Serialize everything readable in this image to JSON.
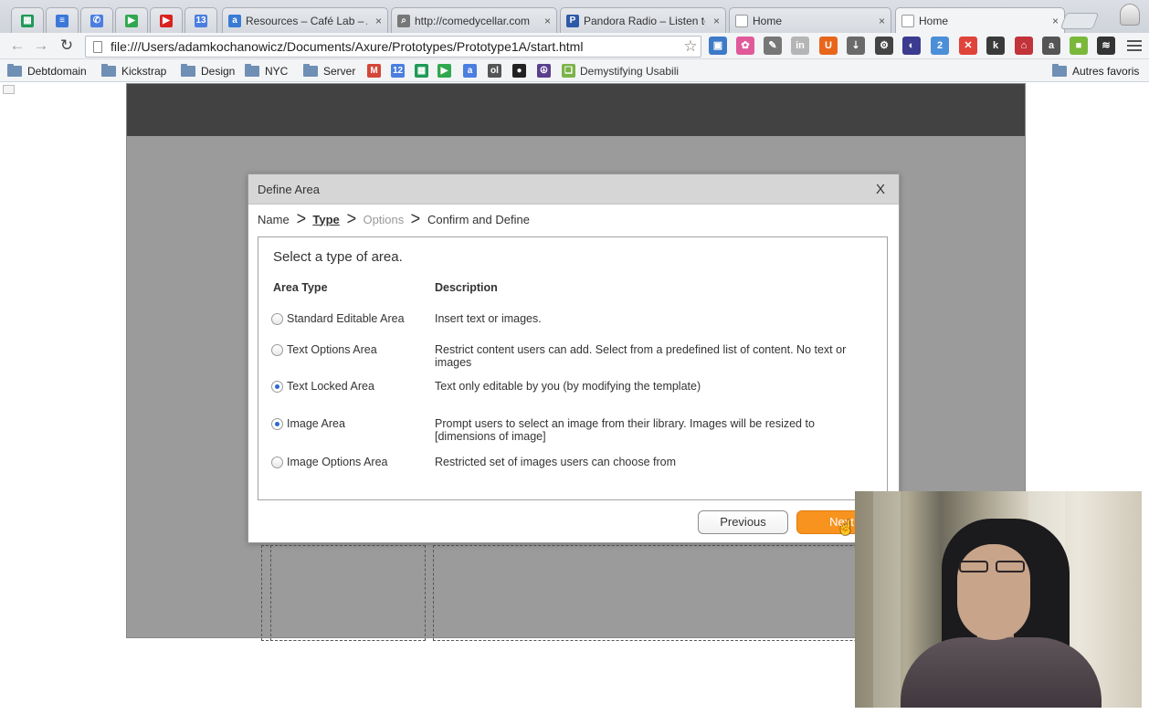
{
  "browser": {
    "pinned_tabs": [
      {
        "icon": "sheets-icon",
        "color": "#1e9a57",
        "glyph": "▦"
      },
      {
        "icon": "docs-icon",
        "color": "#3c78d8",
        "glyph": "≡"
      },
      {
        "icon": "voice-icon",
        "color": "#4a7ee0",
        "glyph": "✆"
      },
      {
        "icon": "play-store-icon",
        "color": "#2fa84f",
        "glyph": "▶"
      },
      {
        "icon": "youtube-icon",
        "color": "#d9231f",
        "glyph": "▶"
      },
      {
        "icon": "calendar-icon",
        "color": "#4a7ee0",
        "glyph": "13"
      }
    ],
    "tabs": [
      {
        "title": "Resources – Café Lab – A",
        "icon": "amazon-icon",
        "color": "#3a7bd5",
        "glyph": "a"
      },
      {
        "title": "http://comedycellar.com",
        "icon": "search-icon",
        "color": "#777777",
        "glyph": "⌕"
      },
      {
        "title": "Pandora Radio – Listen to",
        "icon": "pandora-icon",
        "color": "#2d5aa8",
        "glyph": "P"
      },
      {
        "title": "Home",
        "icon": "page-icon",
        "color": "#ffffff",
        "glyph": ""
      },
      {
        "title": "Home",
        "icon": "page-icon",
        "color": "#ffffff",
        "glyph": ""
      }
    ],
    "tab_close": "×",
    "url": "file:///Users/adamkochanowicz/Documents/Axure/Prototypes/Prototype1A/start.html",
    "nav": {
      "back": "←",
      "forward": "→",
      "reload": "↻",
      "star": "☆"
    },
    "extensions": [
      {
        "icon": "screen-capture-icon",
        "color": "#3d7ac7",
        "glyph": "▣"
      },
      {
        "icon": "color-wheel-icon",
        "color": "#e05a9a",
        "glyph": "✿"
      },
      {
        "icon": "eyedropper-icon",
        "color": "#777777",
        "glyph": "✎"
      },
      {
        "icon": "linkedin-icon",
        "color": "#b5b5b5",
        "glyph": "in"
      },
      {
        "icon": "u-icon",
        "color": "#e8661c",
        "glyph": "U"
      },
      {
        "icon": "download-icon",
        "color": "#6a6a6a",
        "glyph": "⇣"
      },
      {
        "icon": "gear-icon",
        "color": "#444444",
        "glyph": "⚙"
      },
      {
        "icon": "palette-icon",
        "color": "#3b3b8f",
        "glyph": "◐"
      },
      {
        "icon": "tabs-icon",
        "color": "#4a8fd8",
        "glyph": "2"
      },
      {
        "icon": "x-icon",
        "color": "#e0433a",
        "glyph": "✕"
      },
      {
        "icon": "k-icon",
        "color": "#3a3a3a",
        "glyph": "k"
      },
      {
        "icon": "adblock-icon",
        "color": "#c2333a",
        "glyph": "⌂"
      },
      {
        "icon": "amazon-ext-icon",
        "color": "#555555",
        "glyph": "a"
      },
      {
        "icon": "colorzilla-icon",
        "color": "#7ab83c",
        "glyph": "■"
      },
      {
        "icon": "buffer-icon",
        "color": "#333333",
        "glyph": "≋"
      }
    ],
    "bookmarks": [
      {
        "label": "Debtdomain",
        "type": "folder"
      },
      {
        "label": "Kickstrap",
        "type": "folder"
      },
      {
        "label": "Design",
        "type": "folder"
      },
      {
        "label": "NYC",
        "type": "folder"
      },
      {
        "label": "Server",
        "type": "folder"
      }
    ],
    "bookmark_icons": [
      {
        "icon": "gmail-icon",
        "color": "#d44638",
        "glyph": "M"
      },
      {
        "icon": "calendar-icon",
        "color": "#4a7ee0",
        "glyph": "12"
      },
      {
        "icon": "sheets-icon",
        "color": "#1e9a57",
        "glyph": "▦"
      },
      {
        "icon": "play-store-icon",
        "color": "#2fa84f",
        "glyph": "▶"
      },
      {
        "icon": "amazon-icon",
        "color": "#4a7ee0",
        "glyph": "a"
      },
      {
        "icon": "ol-icon",
        "color": "#555555",
        "glyph": "ol"
      },
      {
        "icon": "github-icon",
        "color": "#222222",
        "glyph": "●"
      },
      {
        "icon": "peace-icon",
        "color": "#5a3f8f",
        "glyph": "☮"
      }
    ],
    "bookmark_demystifying": "Demystifying Usabili",
    "other_bookmarks": "Autres favoris"
  },
  "dialog": {
    "title": "Define Area",
    "close": "X",
    "steps": {
      "name": "Name",
      "type": "Type",
      "options": "Options",
      "confirm": "Confirm and Define",
      "separator": ">"
    },
    "heading": "Select a type of area.",
    "columns": {
      "area_type": "Area Type",
      "description": "Description"
    },
    "rows": [
      {
        "label": "Standard Editable Area",
        "description": "Insert text or images.",
        "checked": false
      },
      {
        "label": "Text Options Area",
        "description": "Restrict content users can add. Select from a predefined list of content. No text or images",
        "checked": false
      },
      {
        "label": "Text Locked Area",
        "description": "Text only editable by you (by modifying the template)",
        "checked": true
      },
      {
        "label": "Image Area",
        "description": "Prompt users to select an image from their library. Images will be resized to [dimensions of image]",
        "checked": true
      },
      {
        "label": "Image Options Area",
        "description": "Restricted set of images users can choose from",
        "checked": false
      }
    ],
    "buttons": {
      "previous": "Previous",
      "next": "Next"
    }
  },
  "colors": {
    "accent": "#f7931e",
    "radio_selected": "#2a6bd1"
  }
}
